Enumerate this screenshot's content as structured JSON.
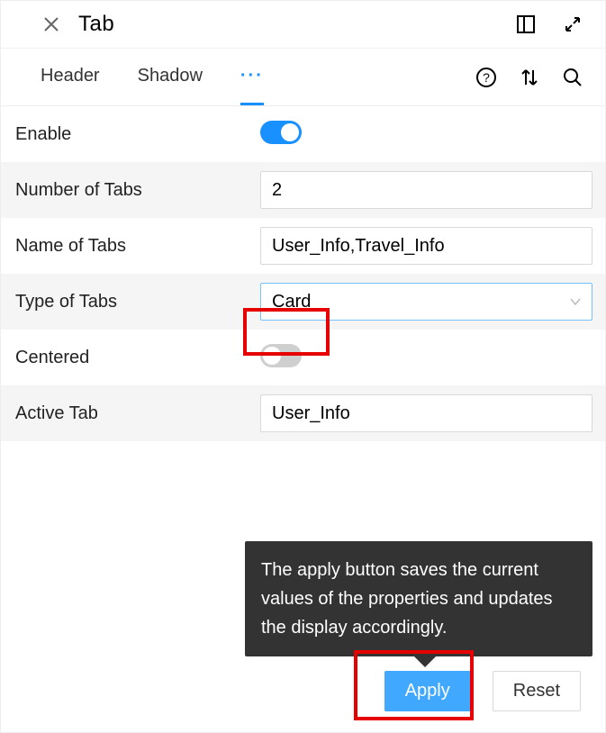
{
  "header": {
    "title": "Tab"
  },
  "tabs": {
    "header": "Header",
    "shadow": "Shadow",
    "more": "···"
  },
  "fields": {
    "enable": {
      "label": "Enable",
      "value": true
    },
    "numTabs": {
      "label": "Number of Tabs",
      "value": "2"
    },
    "nameTabs": {
      "label": "Name of Tabs",
      "value": "User_Info,Travel_Info"
    },
    "typeTabs": {
      "label": "Type of Tabs",
      "value": "Card"
    },
    "centered": {
      "label": "Centered",
      "value": false
    },
    "activeTab": {
      "label": "Active Tab",
      "value": "User_Info"
    }
  },
  "tooltip": "The apply button saves the current values of the properties and updates the display accordingly.",
  "buttons": {
    "apply": "Apply",
    "reset": "Reset"
  }
}
